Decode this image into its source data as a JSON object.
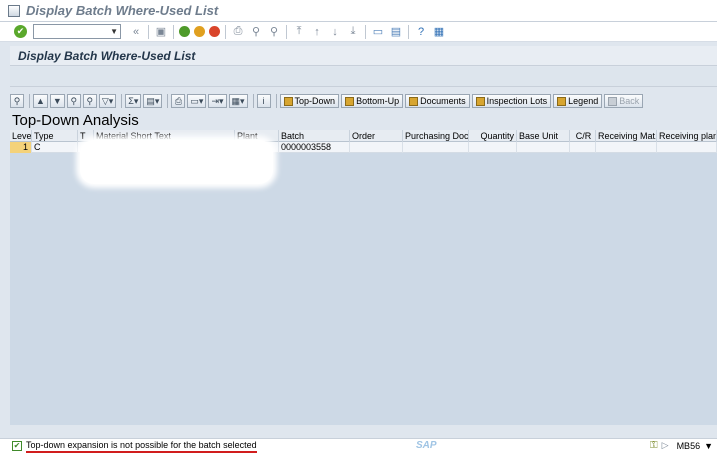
{
  "window": {
    "title": "Display Batch Where-Used List"
  },
  "screen": {
    "title": "Display Batch Where-Used List"
  },
  "alv_toolbar": {
    "buttons": [
      {
        "label": "Top-Down",
        "icon": "top-down-icon"
      },
      {
        "label": "Bottom-Up",
        "icon": "bottom-up-icon"
      },
      {
        "label": "Documents",
        "icon": "documents-icon"
      },
      {
        "label": "Inspection Lots",
        "icon": "inspection-lots-icon"
      },
      {
        "label": "Legend",
        "icon": "legend-icon"
      },
      {
        "label": "Back",
        "icon": "back-icon"
      }
    ]
  },
  "heading": "Top-Down Analysis",
  "table": {
    "columns": [
      "Level",
      "Type",
      "T",
      "Material Short Text",
      "Plant",
      "Batch",
      "Order",
      "Purchasing Doc.",
      "Quantity",
      "Base Unit",
      "C/R",
      "Receiving Mat.",
      "Receiving plant"
    ],
    "rows": [
      {
        "level": "1",
        "type": "C",
        "t": "",
        "material_short_text": "",
        "plant": "",
        "batch": "0000003558",
        "order": "",
        "purchasing_doc": "",
        "quantity": "",
        "base_unit": "",
        "cr": "",
        "receiving_mat": "",
        "receiving_plant": ""
      }
    ]
  },
  "status": {
    "message": "Top-down expansion is not possible for the batch selected",
    "brand": "SAP",
    "transaction": "MB56"
  }
}
